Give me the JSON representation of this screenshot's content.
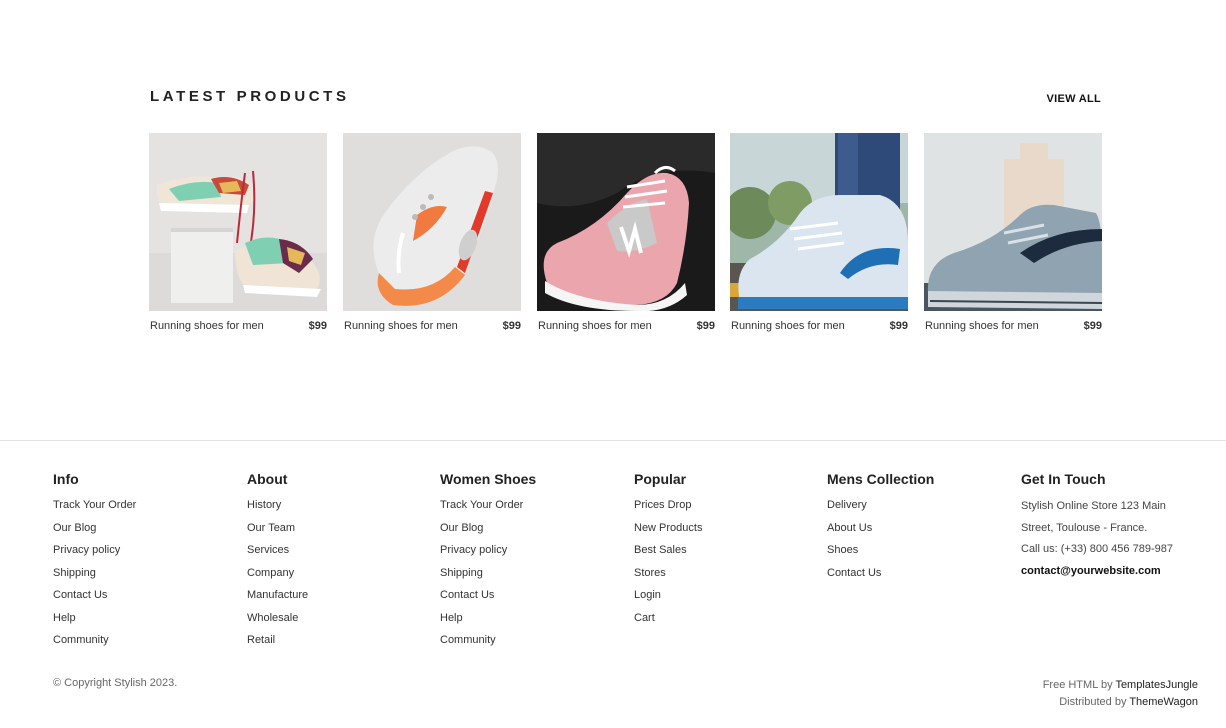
{
  "latest": {
    "title": "LATEST PRODUCTS",
    "view_all": "VIEW ALL",
    "products": [
      {
        "name": "Running shoes for men",
        "price": "$99"
      },
      {
        "name": "Running shoes for men",
        "price": "$99"
      },
      {
        "name": "Running shoes for men",
        "price": "$99"
      },
      {
        "name": "Running shoes for men",
        "price": "$99"
      },
      {
        "name": "Running shoes for men",
        "price": "$99"
      }
    ]
  },
  "footer": {
    "columns": [
      {
        "title": "Info",
        "items": [
          "Track Your Order",
          "Our Blog",
          "Privacy policy",
          "Shipping",
          "Contact Us",
          "Help",
          "Community"
        ]
      },
      {
        "title": "About",
        "items": [
          "History",
          "Our Team",
          "Services",
          "Company",
          "Manufacture",
          "Wholesale",
          "Retail"
        ]
      },
      {
        "title": "Women Shoes",
        "items": [
          "Track Your Order",
          "Our Blog",
          "Privacy policy",
          "Shipping",
          "Contact Us",
          "Help",
          "Community"
        ]
      },
      {
        "title": "Popular",
        "items": [
          "Prices Drop",
          "New Products",
          "Best Sales",
          "Stores",
          "Login",
          "Cart"
        ]
      },
      {
        "title": "Mens Collection",
        "items": [
          "Delivery",
          "About Us",
          "Shoes",
          "Contact Us"
        ]
      }
    ],
    "contact": {
      "title": "Get In Touch",
      "address": "Stylish Online Store 123 Main Street, Toulouse - France.",
      "phone": "Call us: (+33) 800 456 789-987",
      "email": "contact@yourwebsite.com"
    },
    "copyright": "© Copyright Stylish 2023.",
    "credit_html_prefix": "Free HTML by",
    "credit_html_link": "TemplatesJungle",
    "credit_dist_prefix": "Distributed by",
    "credit_dist_link": "ThemeWagon"
  }
}
